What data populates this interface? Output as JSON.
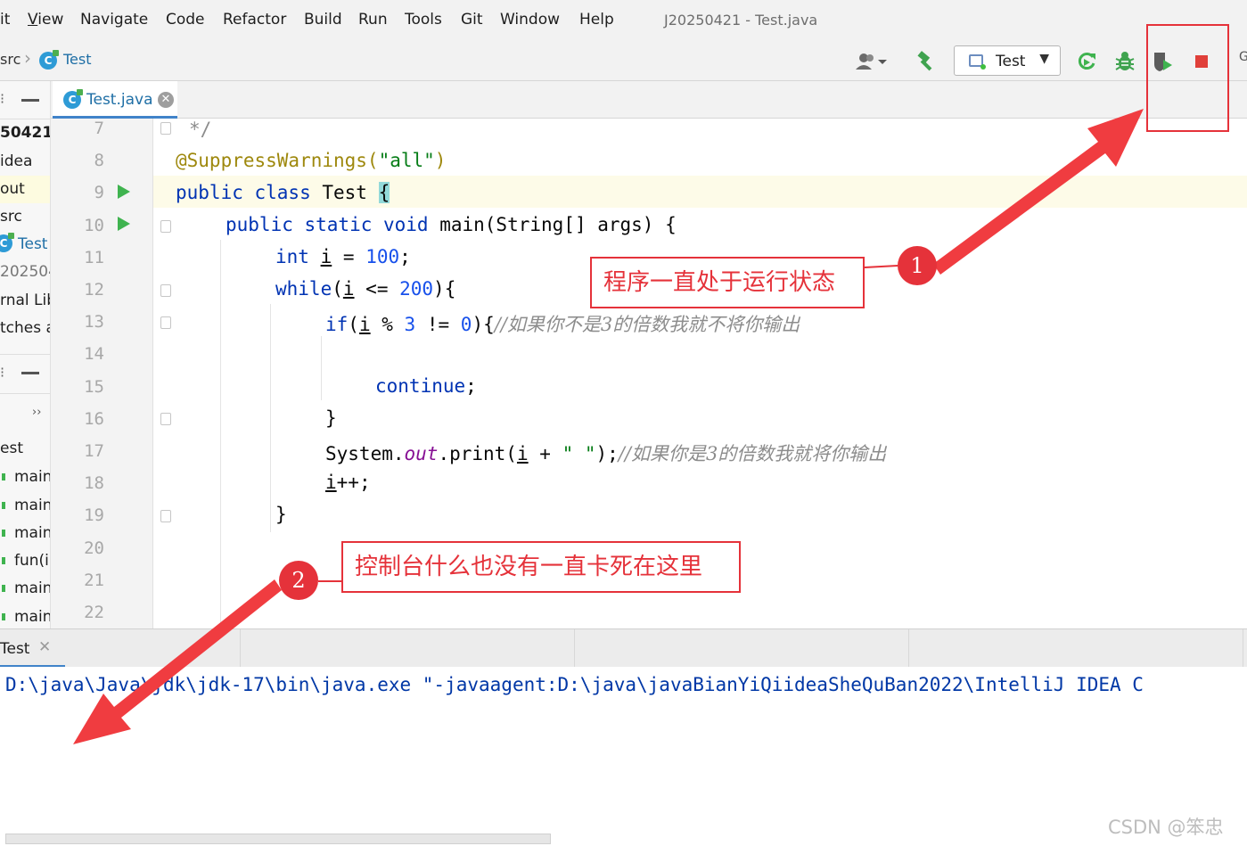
{
  "menu": {
    "items": [
      "it",
      "View",
      "Navigate",
      "Code",
      "Refactor",
      "Build",
      "Run",
      "Tools",
      "Git",
      "Window",
      "Help"
    ],
    "mnemonics": [
      "",
      "V",
      "N",
      "C",
      "R",
      "B",
      "u",
      "T",
      "G",
      "W",
      "H"
    ],
    "window_title": "J20250421 - Test.java"
  },
  "nav": {
    "breadcrumb_src": "src",
    "breadcrumb_class": "Test",
    "run_config_label": "Test",
    "edge_glyph": "G"
  },
  "icons": {
    "run": "play-icon",
    "debug": "bug-icon",
    "stop": "stop-icon",
    "build": "hammer-icon",
    "rerun": "rerun-icon",
    "coverage": "coverage-icon",
    "user": "user-icon"
  },
  "colors": {
    "accent_blue": "#4083c9",
    "run_green": "#3fb34f",
    "stop_red": "#e0403a",
    "annotation_red": "#e5323a"
  },
  "project": {
    "tree": [
      "50421",
      "idea",
      "out",
      "src",
      "Test",
      "202504",
      "rnal Lib",
      "tches ar"
    ],
    "structure_root": "est",
    "structure_items": [
      "main",
      "main",
      "main",
      "fun(ir",
      "main",
      "main"
    ]
  },
  "editor": {
    "tab_label": "Test.java",
    "line_numbers": [
      "7",
      "8",
      "9",
      "10",
      "11",
      "12",
      "13",
      "14",
      "15",
      "16",
      "17",
      "18",
      "19",
      "20",
      "21",
      "22"
    ],
    "code": {
      "l7": "*/",
      "l8_ann": "@SuppressWarnings(",
      "l8_str": "\"all\"",
      "l8_close": ")",
      "l9_kw": "public class",
      "l9_name": " Test ",
      "l9_brace": "{",
      "l10_kw": "public static void",
      "l10_rest": " main(String[] args) {",
      "l11_kw": "int",
      "l11_var": "i",
      "l11_eq": " = ",
      "l11_num": "100",
      "l11_end": ";",
      "l12_kw": "while",
      "l12_open": "(",
      "l12_var": "i",
      "l12_op": " <= ",
      "l12_num": "200",
      "l12_end": "){",
      "l13_kw": "if",
      "l13_open": "(",
      "l13_var": "i",
      "l13_op1": " % ",
      "l13_num1": "3",
      "l13_op2": " != ",
      "l13_num2": "0",
      "l13_end": "){",
      "l13_cmt": "//如果你不是3的倍数我就不将你输出",
      "l15_kw": "continue",
      "l15_end": ";",
      "l16": "}",
      "l17_sys": "System.",
      "l17_fld": "out",
      "l17_print": ".print(",
      "l17_var": "i",
      "l17_plus": " + ",
      "l17_str": "\" \"",
      "l17_end": ");",
      "l17_cmt": "//如果你是3的倍数我就将你输出",
      "l18_var": "i",
      "l18_end": "++;",
      "l19": "}"
    }
  },
  "run_panel": {
    "tab_label": "Test",
    "console_line": "D:\\java\\Java\\jdk\\jdk-17\\bin\\java.exe \"-javaagent:D:\\java\\javaBianYiQiideaSheQuBan2022\\IntelliJ IDEA C"
  },
  "annotations": {
    "callout_1": "程序一直处于运行状态",
    "callout_2": "控制台什么也没有一直卡死在这里",
    "badge_1": "1",
    "badge_2": "2"
  },
  "watermark": "CSDN @笨忠"
}
